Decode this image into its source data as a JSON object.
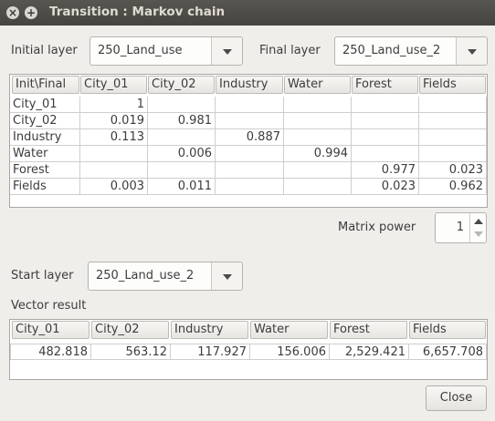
{
  "window": {
    "title": "Transition : Markov chain",
    "close_glyph": "×",
    "maximize_glyph": "+"
  },
  "initial_layer": {
    "label": "Initial layer",
    "value": "250_Land_use"
  },
  "final_layer": {
    "label": "Final layer",
    "value": "250_Land_use_2"
  },
  "matrix": {
    "corner": "Init\\Final",
    "columns": [
      "City_01",
      "City_02",
      "Industry",
      "Water",
      "Forest",
      "Fields"
    ],
    "rows": [
      {
        "name": "City_01",
        "cells": [
          "1",
          "",
          "",
          "",
          "",
          ""
        ]
      },
      {
        "name": "City_02",
        "cells": [
          "0.019",
          "0.981",
          "",
          "",
          "",
          ""
        ]
      },
      {
        "name": "Industry",
        "cells": [
          "0.113",
          "",
          "0.887",
          "",
          "",
          ""
        ]
      },
      {
        "name": "Water",
        "cells": [
          "",
          "0.006",
          "",
          "0.994",
          "",
          ""
        ]
      },
      {
        "name": "Forest",
        "cells": [
          "",
          "",
          "",
          "",
          "0.977",
          "0.023"
        ]
      },
      {
        "name": "Fields",
        "cells": [
          "0.003",
          "0.011",
          "",
          "",
          "0.023",
          "0.962"
        ]
      }
    ]
  },
  "matrix_power": {
    "label": "Matrix power",
    "value": "1"
  },
  "start_layer": {
    "label": "Start layer",
    "value": "250_Land_use_2"
  },
  "vector_result": {
    "label": "Vector result",
    "columns": [
      "City_01",
      "City_02",
      "Industry",
      "Water",
      "Forest",
      "Fields"
    ],
    "values": [
      "482.818",
      "563.12",
      "117.927",
      "156.006",
      "2,529.421",
      "6,657.708"
    ]
  },
  "close_button": "Close"
}
